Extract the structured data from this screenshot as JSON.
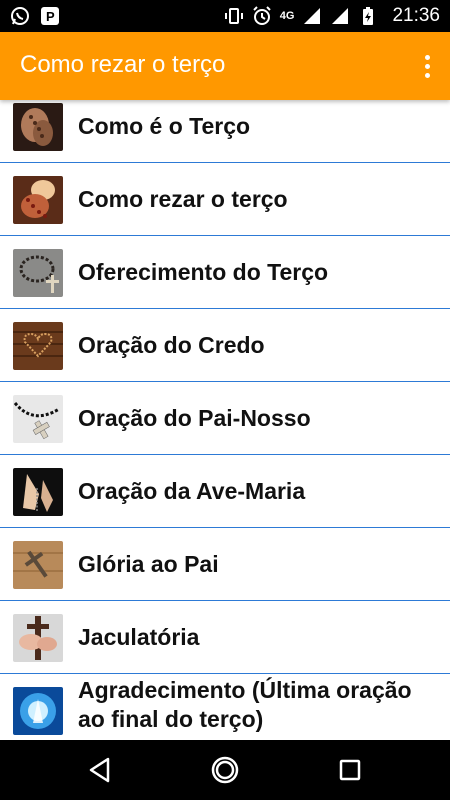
{
  "status_bar": {
    "time": "21:36",
    "network_label": "4G",
    "left_icons": [
      "whatsapp-icon",
      "parking-icon"
    ],
    "right_icons": [
      "vibrate-icon",
      "alarm-icon",
      "signal-4g-icon",
      "signal-icon",
      "battery-charging-icon"
    ]
  },
  "app_bar": {
    "title": "Como rezar o terço",
    "accent_color": "#FF9800"
  },
  "list": {
    "divider_color": "#2d7ad6",
    "items": [
      {
        "label": "Como é o Terço",
        "thumb": "hands-rosary-thumbnail"
      },
      {
        "label": "Como rezar o terço",
        "thumb": "rosary-candle-thumbnail"
      },
      {
        "label": "Oferecimento do Terço",
        "thumb": "rosary-crucifix-thumbnail"
      },
      {
        "label": "Oração do Credo",
        "thumb": "heart-rosary-wood-thumbnail"
      },
      {
        "label": "Oração do Pai-Nosso",
        "thumb": "black-rosary-cross-thumbnail"
      },
      {
        "label": "Oração da Ave-Maria",
        "thumb": "praying-hands-rosary-thumbnail"
      },
      {
        "label": "Glória ao Pai",
        "thumb": "crucifix-on-wood-thumbnail"
      },
      {
        "label": "Jaculatória",
        "thumb": "hand-holding-crucifix-thumbnail"
      },
      {
        "label": "Agradecimento (Última oração ao final do terço)",
        "thumb": "blue-praying-hands-thumbnail"
      }
    ]
  },
  "nav_bar": {
    "buttons": [
      "back-icon",
      "home-icon",
      "recents-icon"
    ]
  }
}
